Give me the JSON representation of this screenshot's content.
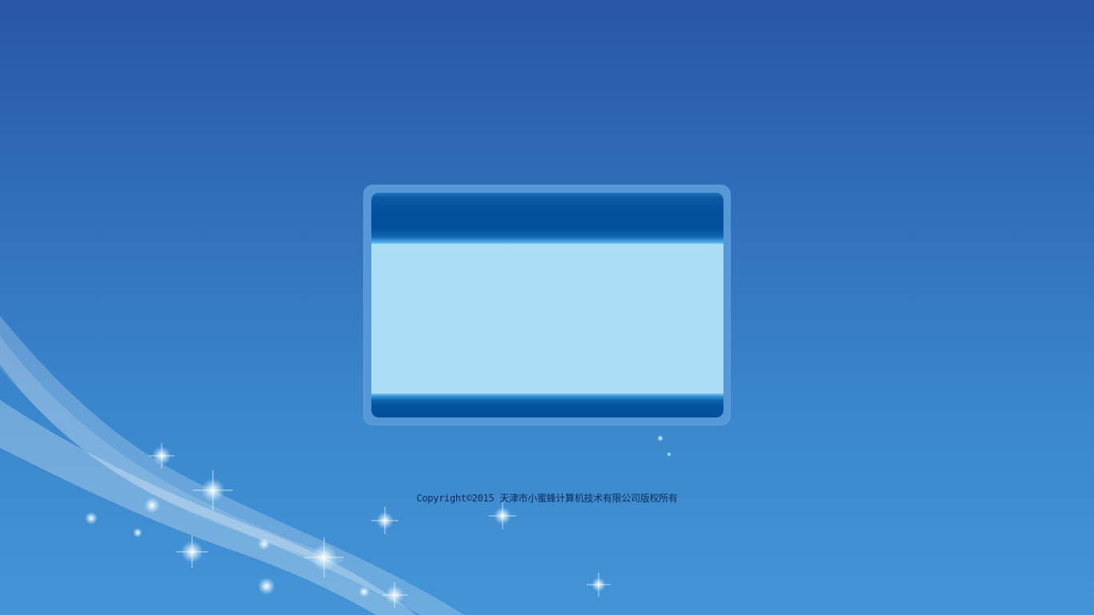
{
  "page": {
    "background_top": "#2a56a7",
    "background_bottom": "#4395d6"
  },
  "login_panel": {
    "frame_color": "#5598d8",
    "header_color": "#02509c",
    "body_color": "#aadef7"
  },
  "footer": {
    "copyright": "Copyright©2015 天津市小蜜蜂计算机技术有限公司版权所有"
  }
}
